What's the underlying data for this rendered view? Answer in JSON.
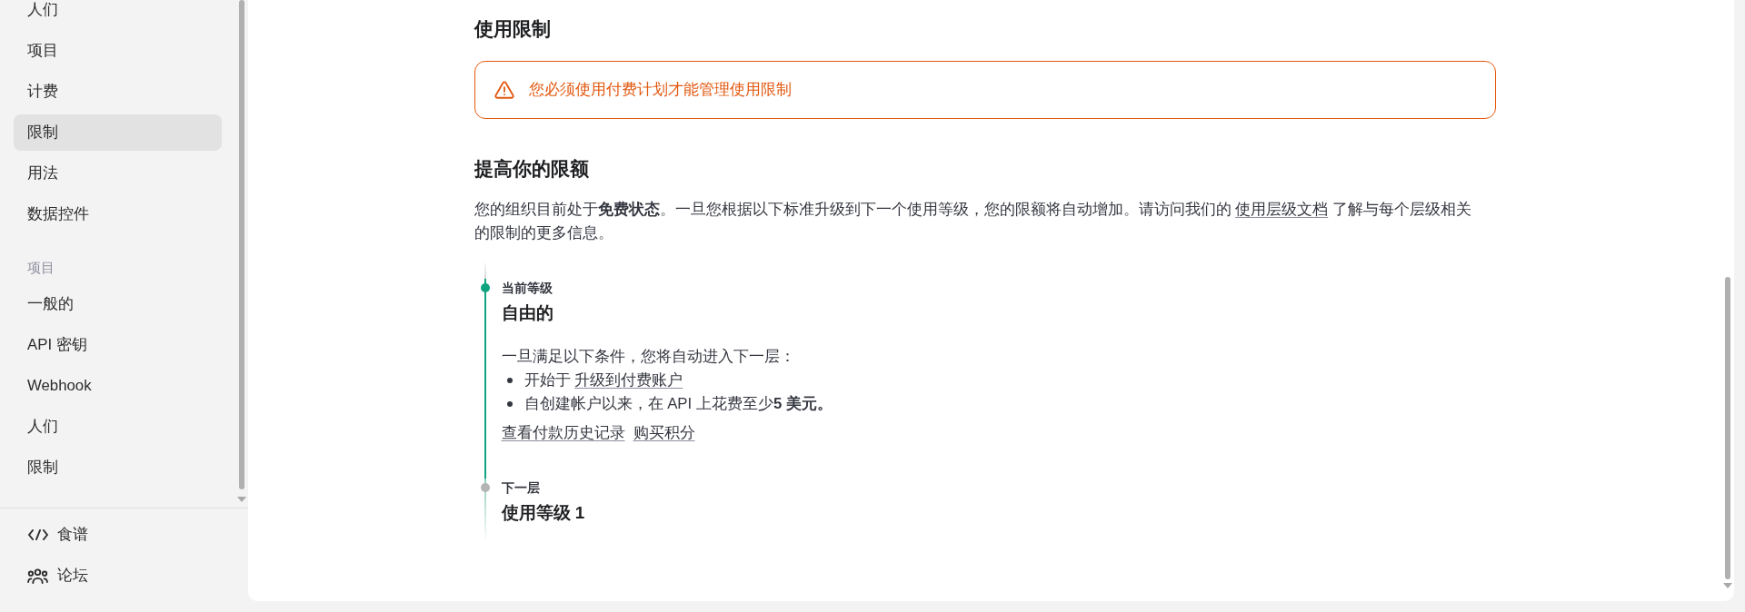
{
  "sidebar": {
    "groups": [
      {
        "items": [
          {
            "label": "人们",
            "selected": false
          },
          {
            "label": "项目",
            "selected": false
          },
          {
            "label": "计费",
            "selected": false
          },
          {
            "label": "限制",
            "selected": true
          },
          {
            "label": "用法",
            "selected": false
          },
          {
            "label": "数据控件",
            "selected": false
          }
        ]
      },
      {
        "heading": "项目",
        "items": [
          {
            "label": "一般的",
            "selected": false
          },
          {
            "label": "API 密钥",
            "selected": false
          },
          {
            "label": "Webhook",
            "selected": false
          },
          {
            "label": "人们",
            "selected": false
          },
          {
            "label": "限制",
            "selected": false
          }
        ]
      }
    ],
    "footer_links": [
      {
        "label": "食谱"
      },
      {
        "label": "论坛"
      }
    ]
  },
  "usage_limits": {
    "title": "使用限制",
    "alert": {
      "message": "您必须使用付费计划才能管理使用限制"
    }
  },
  "increase_limits": {
    "title": "提高你的限额",
    "description_before": "您的组织目前处于**免费状态**。一旦您根据以下标准升级到下一个使用等级，您的限额将自动增加。请访问我们的 ",
    "description_link": "使用层级文档",
    "description_after": " 了解与每个层级相关的限制的更多信息。",
    "tiers": [
      {
        "label": "当前等级",
        "name": "自由的",
        "current": true,
        "conditions_intro": "一旦满足以下条件，您将自动进入下一层：",
        "conditions": [
          {
            "text": "开始于 ",
            "link": "升级到付费账户"
          },
          {
            "text": "自创建帐户以来，在 API 上花费至少**5 美元。**"
          }
        ],
        "links": [
          "查看付款历史记录",
          "购买积分"
        ]
      },
      {
        "label": "下一层",
        "name": "使用等级 1",
        "current": false
      }
    ]
  }
}
